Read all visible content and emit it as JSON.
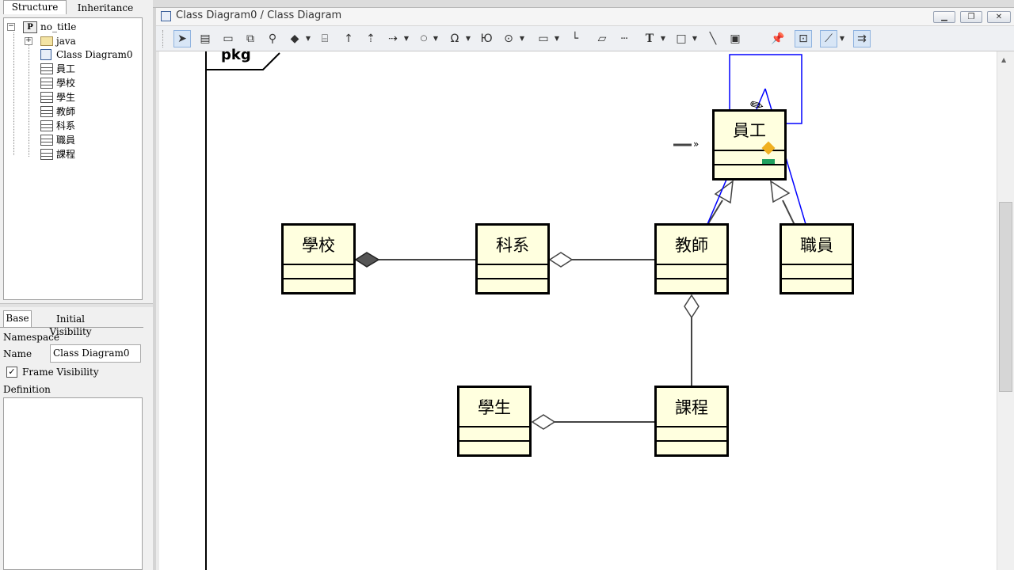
{
  "left_panel": {
    "tabs": [
      "Structure",
      "Inheritance"
    ],
    "tree": {
      "root": "no_title",
      "package": "java",
      "diagram": "Class Diagram0",
      "classes": [
        "員工",
        "學校",
        "學生",
        "教師",
        "科系",
        "職員",
        "課程"
      ]
    },
    "props_tabs": [
      "Base",
      "Initial Visibility"
    ],
    "namespace_label": "Namespace",
    "name_label": "Name",
    "name_value": "Class Diagram0",
    "frame_visibility_label": "Frame Visibility",
    "frame_visibility_checked": true,
    "definition_label": "Definition"
  },
  "window": {
    "title": "Class Diagram0 / Class Diagram"
  },
  "toolbar": {
    "icons": [
      "select-icon",
      "class-icon",
      "package-icon",
      "subsystem-icon",
      "interface-icon",
      "association-icon",
      "composition-icon",
      "dependency-icon",
      "generalization-icon",
      "realization-icon",
      "usage-icon",
      "interface-lollipop-icon",
      "socket-icon",
      "port-icon",
      "note-icon",
      "anchor-icon",
      "frame-icon",
      "text-icon",
      "rectangle-icon",
      "line-icon",
      "image-icon",
      "pin-icon",
      "snap-icon",
      "line-style-icon",
      "align-icon"
    ]
  },
  "diagram": {
    "frame_label": "pkg",
    "classes": {
      "employee": "員工",
      "school": "學校",
      "department": "科系",
      "teacher": "教師",
      "staff": "職員",
      "student": "學生",
      "course": "課程"
    },
    "colors": {
      "class_fill": "#ffffdf",
      "selection": "#0000ff",
      "diamond_filled": "#555555"
    }
  }
}
